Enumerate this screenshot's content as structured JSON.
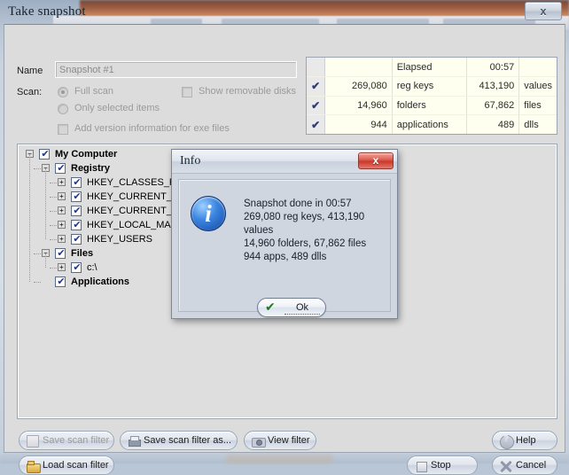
{
  "window": {
    "title": "Take snapshot",
    "close_label": "x",
    "close_icon": "close-icon"
  },
  "form": {
    "name_label": "Name",
    "name_value": "Snapshot #1",
    "name_placeholder": "Snapshot #1",
    "scan_label": "Scan:",
    "radio_full_scan": "Full scan",
    "radio_only_selected": "Only selected items",
    "check_add_version": "Add version information for exe files",
    "check_show_removable": "Show removable disks"
  },
  "stats": {
    "rows": [
      {
        "check": "",
        "num": "",
        "unit": "Elapsed",
        "num2": "00:57",
        "unit2": ""
      },
      {
        "check": "✔",
        "num": "269,080",
        "unit": "reg keys",
        "num2": "413,190",
        "unit2": "values"
      },
      {
        "check": "✔",
        "num": "14,960",
        "unit": "folders",
        "num2": "67,862",
        "unit2": "files"
      },
      {
        "check": "✔",
        "num": "944",
        "unit": "applications",
        "num2": "489",
        "unit2": "dlls"
      }
    ]
  },
  "tree": {
    "items": [
      {
        "label": "My Computer",
        "depth": 0,
        "bold": true,
        "expander": "−",
        "checked": true
      },
      {
        "label": "Registry",
        "depth": 1,
        "bold": true,
        "expander": "−",
        "checked": true
      },
      {
        "label": "HKEY_CLASSES_ROOT",
        "depth": 2,
        "bold": false,
        "expander": "+",
        "checked": true
      },
      {
        "label": "HKEY_CURRENT_CONFIG",
        "depth": 2,
        "bold": false,
        "expander": "+",
        "checked": true
      },
      {
        "label": "HKEY_CURRENT_USER",
        "depth": 2,
        "bold": false,
        "expander": "+",
        "checked": true
      },
      {
        "label": "HKEY_LOCAL_MACHINE",
        "depth": 2,
        "bold": false,
        "expander": "+",
        "checked": true
      },
      {
        "label": "HKEY_USERS",
        "depth": 2,
        "bold": false,
        "expander": "+",
        "checked": true
      },
      {
        "label": "Files",
        "depth": 1,
        "bold": true,
        "expander": "−",
        "checked": true
      },
      {
        "label": "c:\\",
        "depth": 2,
        "bold": false,
        "expander": "+",
        "checked": true
      },
      {
        "label": "Applications",
        "depth": 1,
        "bold": true,
        "expander": "",
        "checked": true
      }
    ]
  },
  "buttons": {
    "save_scan_filter": "Save scan filter",
    "save_scan_filter_as": "Save scan filter as...",
    "view_filter": "View filter",
    "load_scan_filter": "Load scan filter",
    "help": "Help",
    "stop": "Stop",
    "cancel": "Cancel"
  },
  "info_dialog": {
    "title": "Info",
    "close_label": "x",
    "lines": [
      "Snapshot done in 00:57",
      "269,080 reg keys, 413,190 values",
      "14,960 folders, 67,862 files",
      "944 apps, 489 dlls"
    ],
    "ok_label": "Ok",
    "ok_check": "✔"
  },
  "colors": {
    "window_bg": "#dcdcdc",
    "tree_bg": "#dedede",
    "stats_bg": "#fffff0",
    "check_blue": "#23348e",
    "info_bg": "#cfd6e0",
    "close_red": "#c9392c",
    "ok_green": "#177d17"
  }
}
